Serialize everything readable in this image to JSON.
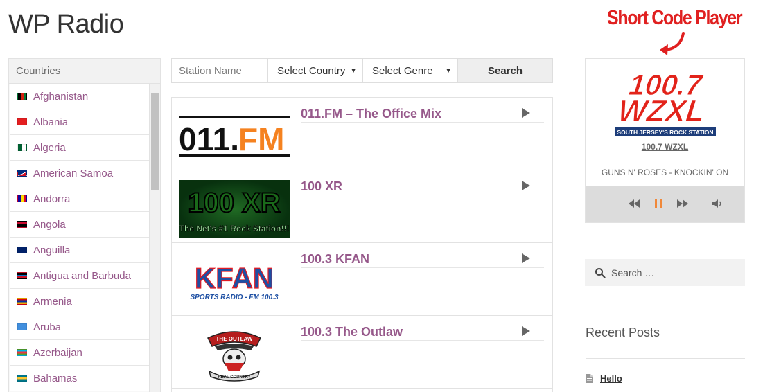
{
  "site": {
    "title": "WP Radio"
  },
  "countries": {
    "heading": "Countries",
    "items": [
      {
        "name": "Afghanistan",
        "flag_colors": [
          "#000000",
          "#d32011",
          "#007a36"
        ]
      },
      {
        "name": "Albania",
        "flag_colors": [
          "#e41e20",
          "#e41e20",
          "#e41e20"
        ]
      },
      {
        "name": "Algeria",
        "flag_colors": [
          "#006233",
          "#ffffff",
          "#d21034"
        ]
      },
      {
        "name": "American Samoa",
        "flag_colors": [
          "#002b7f",
          "#ffffff",
          "#ce1126"
        ]
      },
      {
        "name": "Andorra",
        "flag_colors": [
          "#10069f",
          "#fedd00",
          "#d50032"
        ]
      },
      {
        "name": "Angola",
        "flag_colors": [
          "#cc092f",
          "#cc092f",
          "#000000"
        ]
      },
      {
        "name": "Anguilla",
        "flag_colors": [
          "#012169",
          "#012169",
          "#ffffff"
        ]
      },
      {
        "name": "Antigua and Barbuda",
        "flag_colors": [
          "#ce1126",
          "#000000",
          "#ce1126"
        ]
      },
      {
        "name": "Armenia",
        "flag_colors": [
          "#d90012",
          "#0033a0",
          "#f2a800"
        ]
      },
      {
        "name": "Aruba",
        "flag_colors": [
          "#418fde",
          "#fcdd09",
          "#418fde"
        ]
      },
      {
        "name": "Azerbaijan",
        "flag_colors": [
          "#00b5e2",
          "#ef3340",
          "#509e2f"
        ]
      },
      {
        "name": "Bahamas",
        "flag_colors": [
          "#00778b",
          "#ffc72c",
          "#00778b"
        ]
      }
    ]
  },
  "search": {
    "station_placeholder": "Station Name",
    "country_select": "Select Country",
    "genre_select": "Select Genre",
    "button_label": "Search"
  },
  "stations": [
    {
      "name": "011.FM – The Office Mix",
      "logo_text_a": "011.",
      "logo_text_b": "FM"
    },
    {
      "name": "100 XR",
      "logo_text_a": "100 XR",
      "logo_text_b": "The Net's #1 Rock Station!!!"
    },
    {
      "name": "100.3 KFAN",
      "logo_text_a": "KFAN",
      "logo_text_b": "SPORTS RADIO - FM 100.3"
    },
    {
      "name": "100.3 The Outlaw",
      "logo_text_a": "THE OUTLAW",
      "logo_text_b": "REAL COUNTRY"
    }
  ],
  "annotation": {
    "text": "Short Code Player"
  },
  "player": {
    "logo_line1": "100.7",
    "logo_line2": "WZXL",
    "logo_tagline": "SOUTH JERSEY'S ROCK STATION",
    "station_title": "100.7 WZXL",
    "now_playing": "GUNS N' ROSES - KNOCKIN' ON",
    "accent": "#f0883a",
    "icons": [
      "rewind-icon",
      "pause-icon",
      "fast-forward-icon",
      "volume-icon"
    ]
  },
  "sidebar_search": {
    "placeholder": "Search …"
  },
  "recent_posts": {
    "heading": "Recent Posts",
    "items": [
      {
        "title": "Hello"
      }
    ]
  },
  "colors": {
    "link": "#96588a",
    "annotation": "#e02020"
  }
}
